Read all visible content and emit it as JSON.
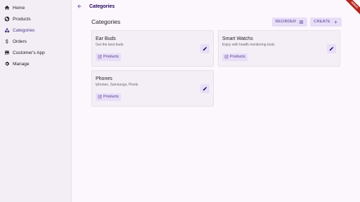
{
  "sidebar": {
    "items": [
      {
        "label": "Home",
        "icon": "home-icon",
        "active": false
      },
      {
        "label": "Products",
        "icon": "products-icon",
        "active": false
      },
      {
        "label": "Categories",
        "icon": "categories-icon",
        "active": true
      },
      {
        "label": "Orders",
        "icon": "dollar-icon",
        "active": false
      },
      {
        "label": "Customer's App",
        "icon": "storefront-icon",
        "active": false
      },
      {
        "label": "Manage",
        "icon": "gear-icon",
        "active": false
      }
    ]
  },
  "topbar": {
    "title": "Categories"
  },
  "main": {
    "page_title": "Categories",
    "reorder_label": "REORDER",
    "create_label": "CREATE"
  },
  "categories": [
    {
      "title": "Ear Buds",
      "description": "Get the best buds",
      "chip_label": "Products"
    },
    {
      "title": "Smart Watchs",
      "description": "Enjoy with health monitoring tools",
      "chip_label": "Products"
    },
    {
      "title": "Phones",
      "description": "Iphones, Samsungs, Pixels",
      "chip_label": "Products"
    }
  ],
  "debug_banner": "DEBUG",
  "colors": {
    "accent": "#4f378b",
    "accent_container": "#e8def8",
    "background": "#fcf7fd",
    "sidebar_bg": "#f3eef5",
    "banner": "#b3261e"
  }
}
